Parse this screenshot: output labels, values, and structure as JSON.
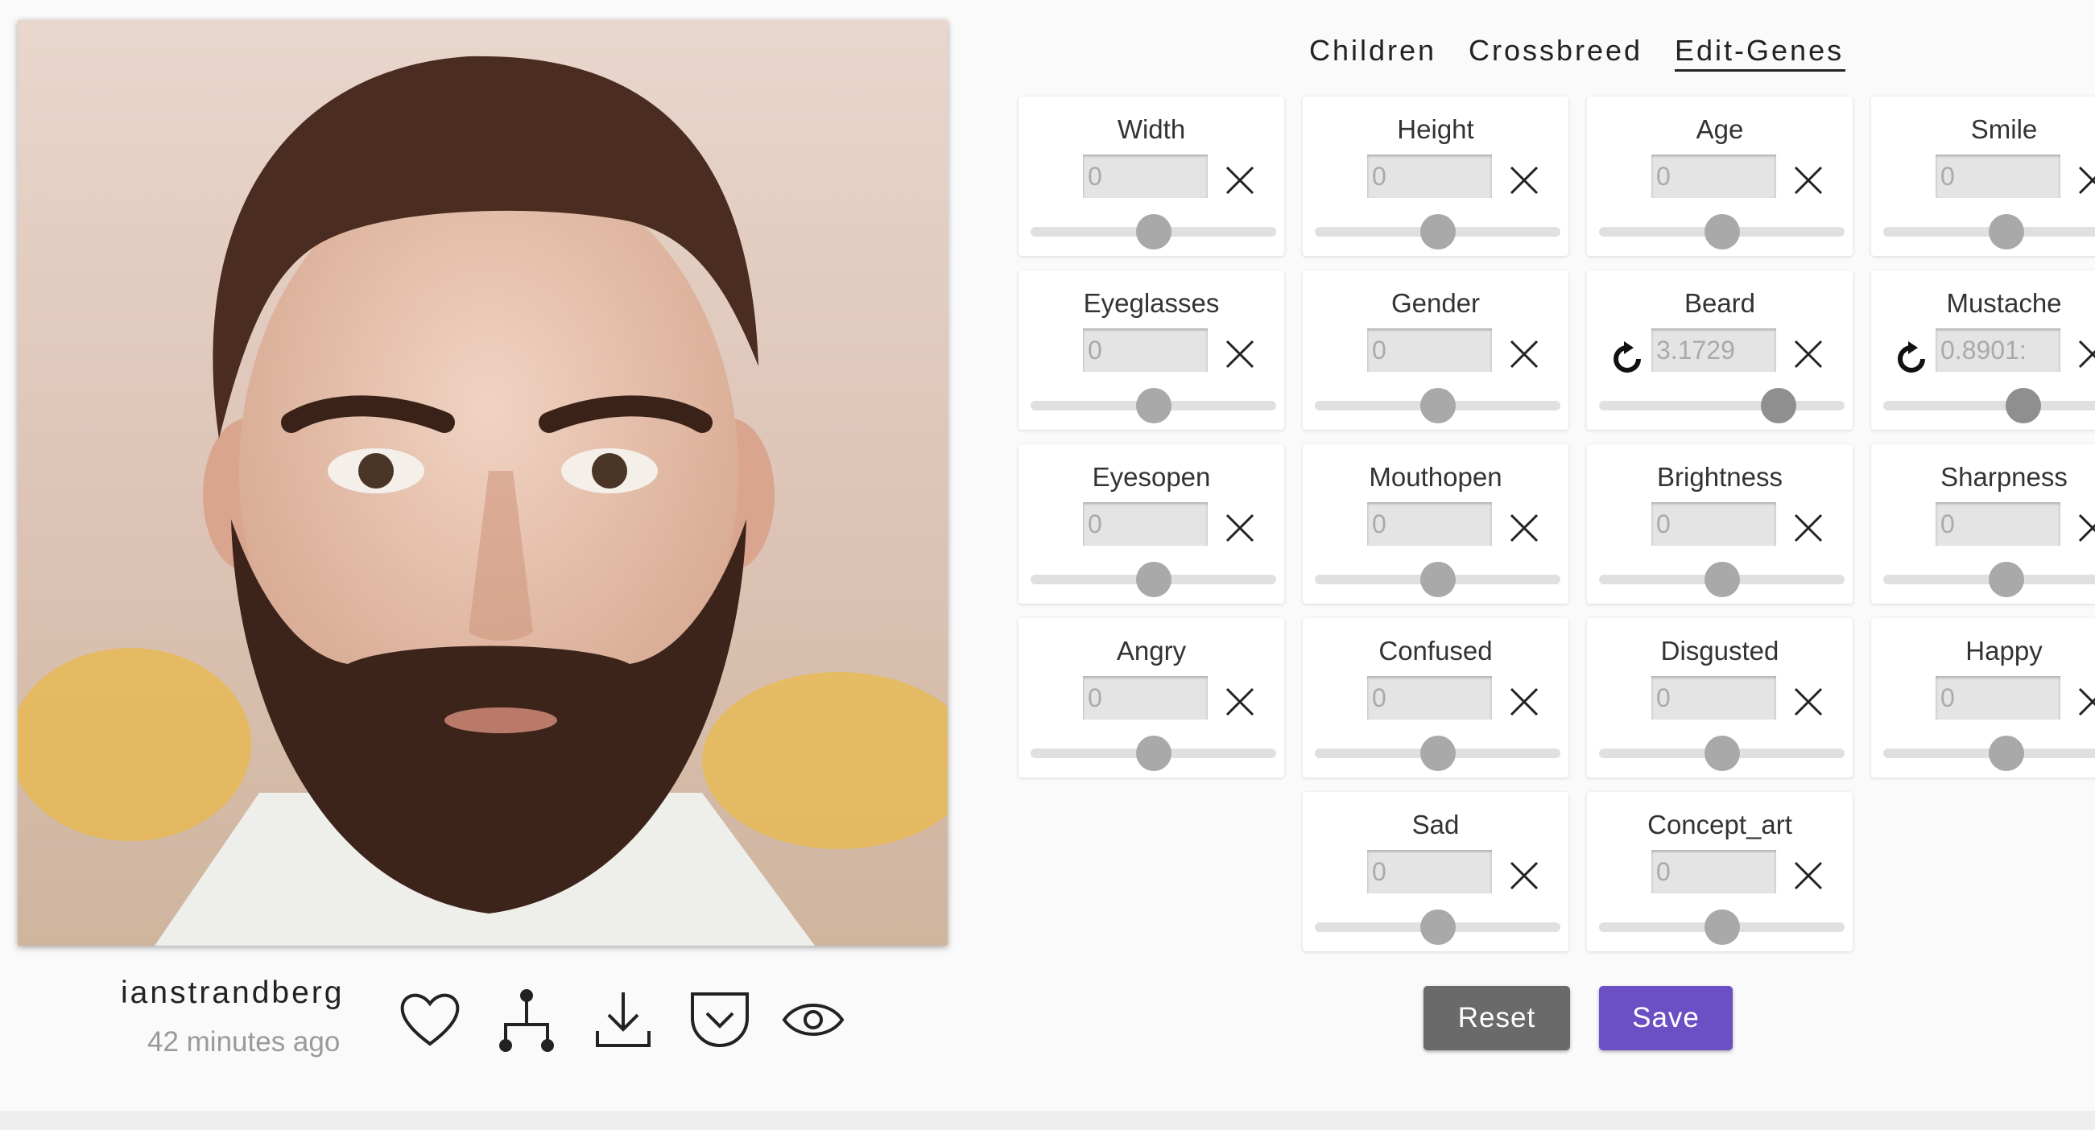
{
  "colors": {
    "accent": "#6b4fc4",
    "reset_button": "#6a6a6a",
    "slider_thumb": "#a9a9a9",
    "background": "#fafafa"
  },
  "post": {
    "username": "ianstrandberg",
    "time_ago": "42 minutes ago",
    "actions": [
      "heart-icon",
      "family-tree-icon",
      "download-icon",
      "pocket-save-icon",
      "eye-icon"
    ]
  },
  "tabs": [
    {
      "label": "Children",
      "active": false
    },
    {
      "label": "Crossbreed",
      "active": false
    },
    {
      "label": "Edit-Genes",
      "active": true
    }
  ],
  "genes": [
    {
      "label": "Width",
      "value": "0",
      "slider": 0.5,
      "modified": false
    },
    {
      "label": "Height",
      "value": "0",
      "slider": 0.5,
      "modified": false
    },
    {
      "label": "Age",
      "value": "0",
      "slider": 0.5,
      "modified": false
    },
    {
      "label": "Smile",
      "value": "0",
      "slider": 0.5,
      "modified": false
    },
    {
      "label": "Eyeglasses",
      "value": "0",
      "slider": 0.5,
      "modified": false
    },
    {
      "label": "Gender",
      "value": "0",
      "slider": 0.5,
      "modified": false
    },
    {
      "label": "Beard",
      "value": "3.1729",
      "slider": 0.73,
      "modified": true
    },
    {
      "label": "Mustache",
      "value": "0.8901:",
      "slider": 0.57,
      "modified": true
    },
    {
      "label": "Eyesopen",
      "value": "0",
      "slider": 0.5,
      "modified": false
    },
    {
      "label": "Mouthopen",
      "value": "0",
      "slider": 0.5,
      "modified": false
    },
    {
      "label": "Brightness",
      "value": "0",
      "slider": 0.5,
      "modified": false
    },
    {
      "label": "Sharpness",
      "value": "0",
      "slider": 0.5,
      "modified": false
    },
    {
      "label": "Angry",
      "value": "0",
      "slider": 0.5,
      "modified": false
    },
    {
      "label": "Confused",
      "value": "0",
      "slider": 0.5,
      "modified": false
    },
    {
      "label": "Disgusted",
      "value": "0",
      "slider": 0.5,
      "modified": false
    },
    {
      "label": "Happy",
      "value": "0",
      "slider": 0.5,
      "modified": false
    },
    {
      "label": "Sad",
      "value": "0",
      "slider": 0.5,
      "modified": false
    },
    {
      "label": "Concept_art",
      "value": "0",
      "slider": 0.5,
      "modified": false
    }
  ],
  "buttons": {
    "reset": "Reset",
    "save": "Save"
  }
}
